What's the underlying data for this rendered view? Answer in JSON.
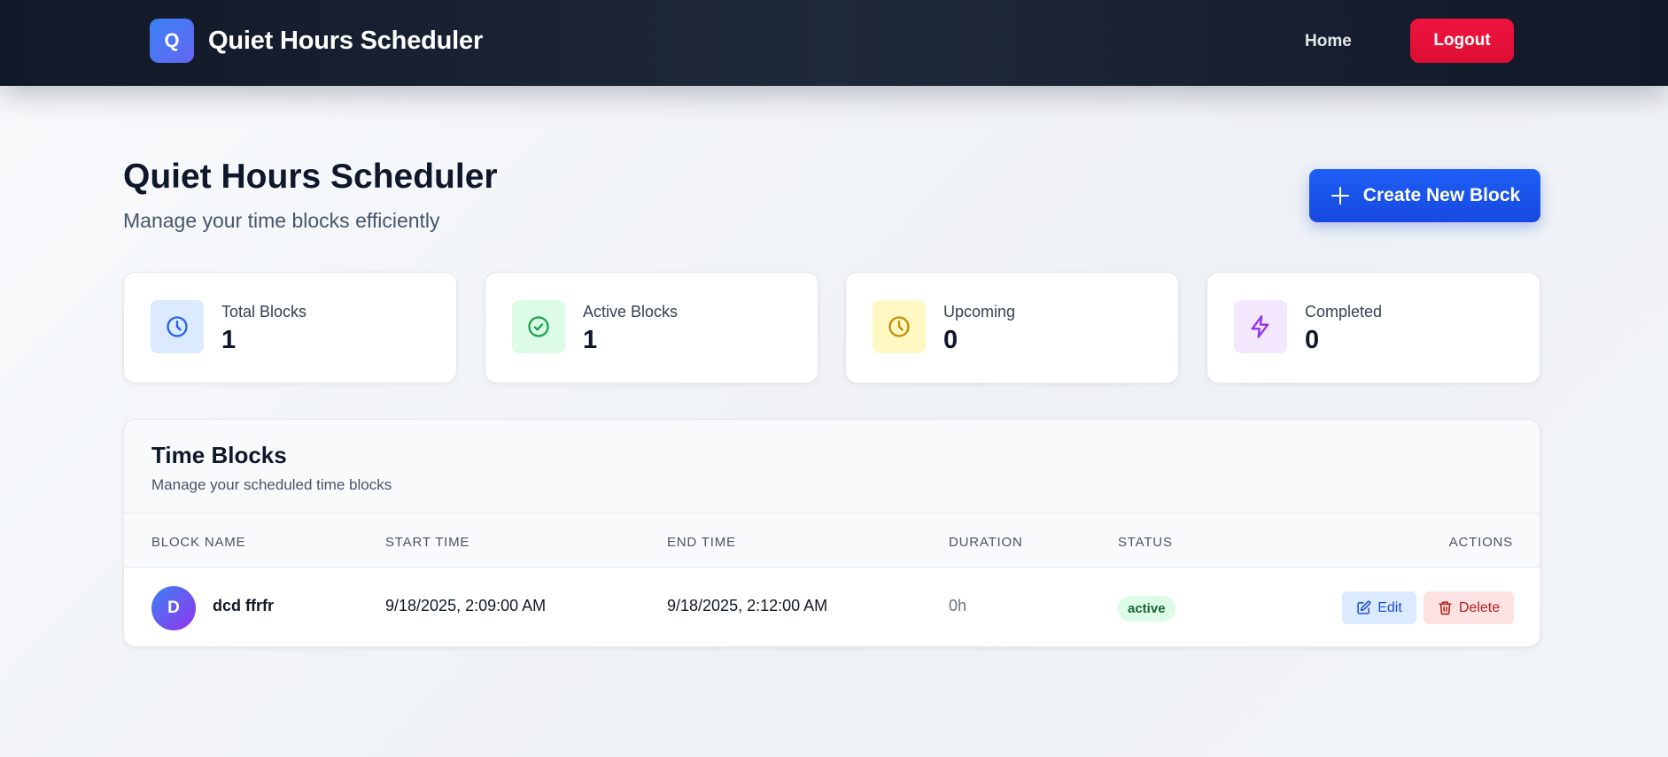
{
  "navbar": {
    "logo_letter": "Q",
    "title": "Quiet Hours Scheduler",
    "home_label": "Home",
    "logout_label": "Logout"
  },
  "header": {
    "title": "Quiet Hours Scheduler",
    "subtitle": "Manage your time blocks efficiently",
    "create_button_label": "Create New Block"
  },
  "stats": [
    {
      "label": "Total Blocks",
      "value": "1",
      "icon": "clock-icon",
      "color": "#2563eb",
      "bg": "#dbeafe"
    },
    {
      "label": "Active Blocks",
      "value": "1",
      "icon": "check-circle-icon",
      "color": "#16a34a",
      "bg": "#dcfce7"
    },
    {
      "label": "Upcoming",
      "value": "0",
      "icon": "clock-icon",
      "color": "#ca8a04",
      "bg": "#fef9c3"
    },
    {
      "label": "Completed",
      "value": "0",
      "icon": "lightning-icon",
      "color": "#9333ea",
      "bg": "#f3e8ff"
    }
  ],
  "table": {
    "title": "Time Blocks",
    "subtitle": "Manage your scheduled time blocks",
    "columns": [
      "BLOCK NAME",
      "START TIME",
      "END TIME",
      "DURATION",
      "STATUS",
      "ACTIONS"
    ],
    "rows": [
      {
        "avatar_letter": "D",
        "name": "dcd ffrfr",
        "start": "9/18/2025, 2:09:00 AM",
        "end": "9/18/2025, 2:12:00 AM",
        "duration": "0h",
        "status": "active",
        "edit_label": "Edit",
        "delete_label": "Delete"
      }
    ]
  },
  "colors": {
    "primary": "#1d5ff5",
    "logout": "#e11d48",
    "navbar": "#111827",
    "status_active_bg": "#dcfce7",
    "status_active_text": "#166534"
  }
}
